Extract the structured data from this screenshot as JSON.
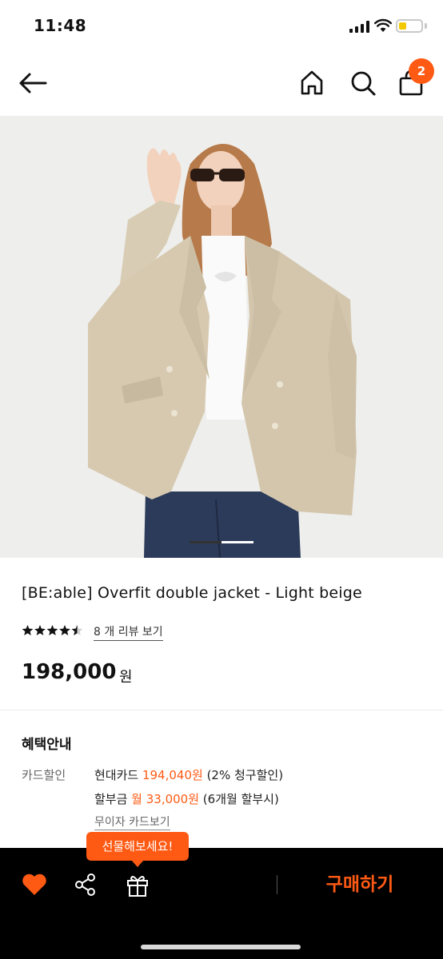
{
  "status_bar": {
    "time": "11:48"
  },
  "header": {
    "back_icon": "arrow-left-icon",
    "home_icon": "home-icon",
    "search_icon": "search-icon",
    "cart_icon": "shopping-bag-icon",
    "cart_count": "2"
  },
  "product": {
    "image_description_icon": "model-wearing-beige-jacket",
    "title": "[BE:able] Overfit double jacket - Light beige",
    "rating_stars": 4.5,
    "review_link": "8 개 리뷰 보기",
    "price": "198,000",
    "price_unit": "원"
  },
  "benefits": {
    "title": "혜택안내",
    "card_label": "카드할인",
    "line1": {
      "prefix": "현대카드 ",
      "accent": "194,040원",
      "suffix": " (2% 청구할인)"
    },
    "line2": {
      "prefix": "할부금 ",
      "accent": "월 33,000원",
      "suffix": " (6개월 할부시)"
    },
    "interest_free_link": "무이자 카드보기"
  },
  "bottom_bar": {
    "gift_tooltip": "선물해보세요!",
    "buy_label": "구매하기",
    "like_icon": "heart-icon",
    "share_icon": "share-icon",
    "gift_icon": "gift-icon"
  },
  "colors": {
    "accent": "#ff5a14",
    "bottom_bar_bg": "#000000",
    "image_bg": "#efefed"
  }
}
